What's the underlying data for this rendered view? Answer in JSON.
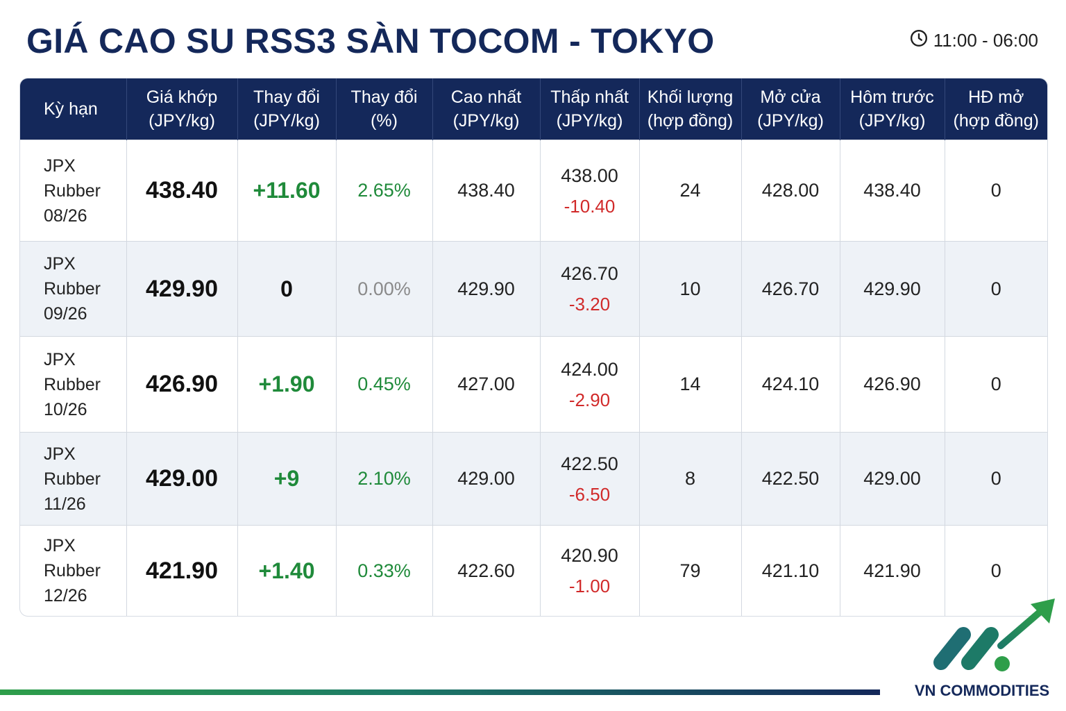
{
  "page": {
    "title": "GIÁ CAO SU RSS3 SÀN TOCOM - TOKYO",
    "session_time": "11:00 - 06:00",
    "session_icon": "clock-icon"
  },
  "table": {
    "headers": [
      {
        "line1": "Kỳ hạn",
        "line2": ""
      },
      {
        "line1": "Giá khớp",
        "line2": "(JPY/kg)"
      },
      {
        "line1": "Thay đổi",
        "line2": "(JPY/kg)"
      },
      {
        "line1": "Thay đổi",
        "line2": "(%)"
      },
      {
        "line1": "Cao nhất",
        "line2": "(JPY/kg)"
      },
      {
        "line1": "Thấp nhất",
        "line2": "(JPY/kg)"
      },
      {
        "line1": "Khối lượng",
        "line2": "(hợp đồng)"
      },
      {
        "line1": "Mở cửa",
        "line2": "(JPY/kg)"
      },
      {
        "line1": "Hôm trước",
        "line2": "(JPY/kg)"
      },
      {
        "line1": "HĐ mở",
        "line2": "(hợp đồng)"
      }
    ],
    "rows": [
      {
        "term_l1": "JPX",
        "term_l2": "Rubber",
        "term_l3": "08/26",
        "price": "438.40",
        "change": "+11.60",
        "change_dir": "up",
        "change_pct": "2.65%",
        "high": "438.40",
        "low": "438.00",
        "low_delta": "-10.40",
        "volume": "24",
        "open": "428.00",
        "previous": "438.40",
        "open_interest": "0"
      },
      {
        "term_l1": "JPX",
        "term_l2": "Rubber",
        "term_l3": "09/26",
        "price": "429.90",
        "change": "0",
        "change_dir": "flat",
        "change_pct": "0.00%",
        "high": "429.90",
        "low": "426.70",
        "low_delta": "-3.20",
        "volume": "10",
        "open": "426.70",
        "previous": "429.90",
        "open_interest": "0"
      },
      {
        "term_l1": "JPX",
        "term_l2": "Rubber",
        "term_l3": "10/26",
        "price": "426.90",
        "change": "+1.90",
        "change_dir": "up",
        "change_pct": "0.45%",
        "high": "427.00",
        "low": "424.00",
        "low_delta": "-2.90",
        "volume": "14",
        "open": "424.10",
        "previous": "426.90",
        "open_interest": "0"
      },
      {
        "term_l1": "JPX",
        "term_l2": "Rubber",
        "term_l3": "11/26",
        "price": "429.00",
        "change": "+9",
        "change_dir": "up",
        "change_pct": "2.10%",
        "high": "429.00",
        "low": "422.50",
        "low_delta": "-6.50",
        "volume": "8",
        "open": "422.50",
        "previous": "429.00",
        "open_interest": "0"
      },
      {
        "term_l1": "JPX",
        "term_l2": "Rubber",
        "term_l3": "12/26",
        "price": "421.90",
        "change": "+1.40",
        "change_dir": "up",
        "change_pct": "0.33%",
        "high": "422.60",
        "low": "420.90",
        "low_delta": "-1.00",
        "volume": "79",
        "open": "421.10",
        "previous": "421.90",
        "open_interest": "0"
      }
    ]
  },
  "brand": {
    "name": "VN COMMODITIES",
    "logo_icon": "rising-arrow-logo-icon"
  },
  "colors": {
    "header_bg": "#14285a",
    "positive": "#1f8a3a",
    "negative": "#d12a2a",
    "neutral_pct": "#8a8a8a",
    "row_alt": "#eef2f7"
  }
}
